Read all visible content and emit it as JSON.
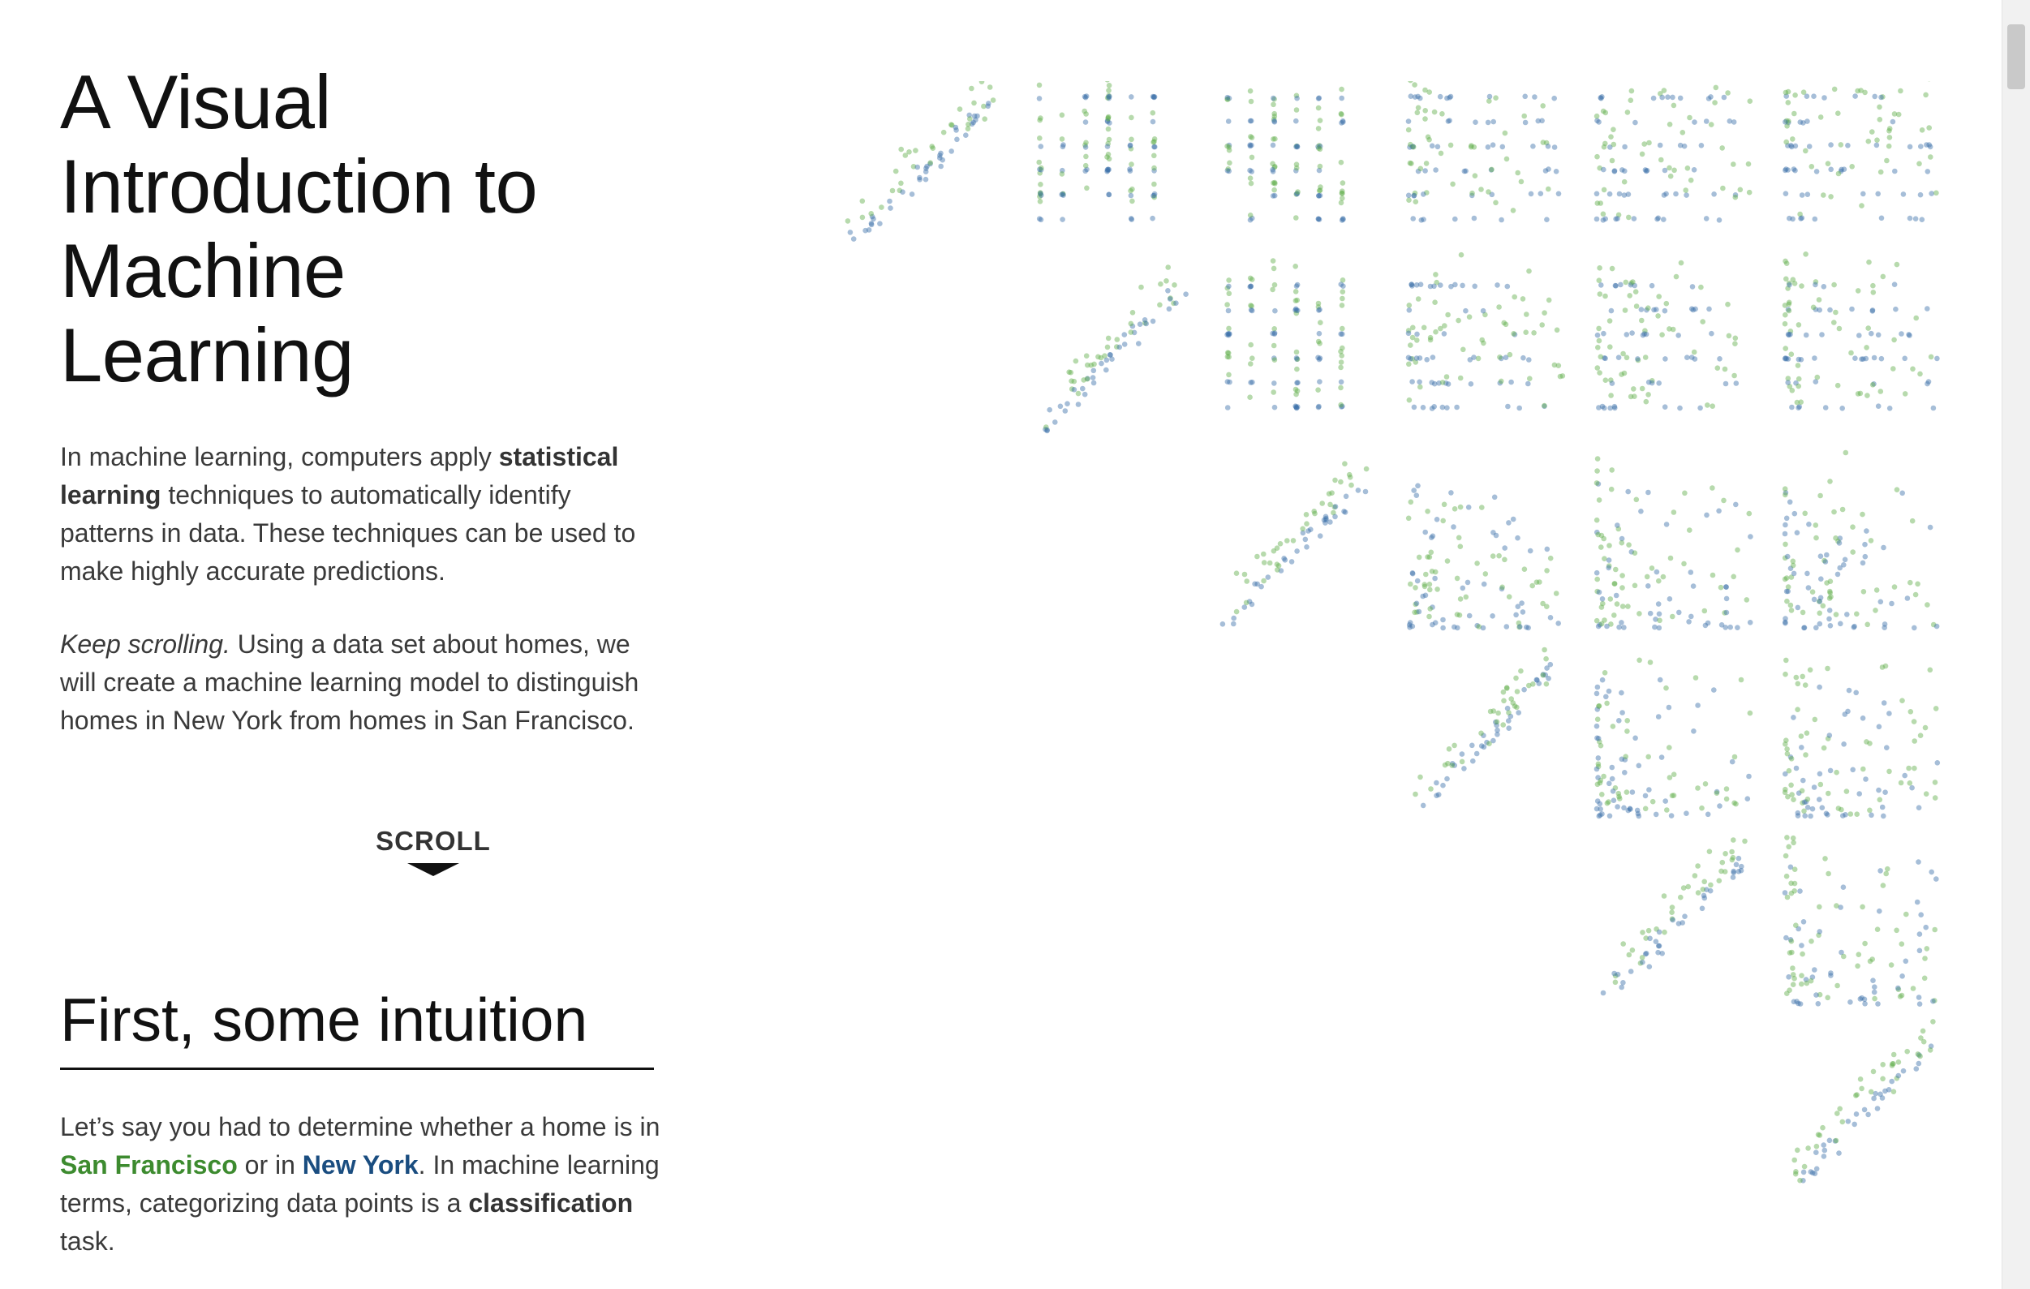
{
  "title_lines": [
    "A Visual",
    "Introduction to",
    "Machine",
    "Learning"
  ],
  "intro": {
    "t1": "In machine learning, computers apply ",
    "bold1": "statistical learning",
    "t2": " techniques to automatically identify patterns in data. These techniques can be used to make highly accurate predictions."
  },
  "keep": {
    "italic": "Keep scrolling.",
    "text": " Using a data set about homes, we will create a machine learning model to distinguish homes in New York from homes in San Francisco."
  },
  "scroll_cue": {
    "label": "SCROLL",
    "icon": "triangle-down-icon"
  },
  "section": {
    "heading": "First, some intuition",
    "t1": "Let’s say you had to determine whether a home is in ",
    "sf": "San Francisco",
    "t2": " or in ",
    "ny": "New York",
    "t3": ". In machine learning terms, categorizing data points is a ",
    "bold": "classification",
    "t4": " task."
  },
  "colors": {
    "san_francisco": "#3d8b2f",
    "new_york": "#1a4d80",
    "sf_point": "#5fae4a",
    "ny_point": "#3a6fa8"
  },
  "viz": {
    "type": "scatterplot-matrix",
    "series": [
      {
        "name": "San Francisco",
        "color": "#5fae4a"
      },
      {
        "name": "New York",
        "color": "#3a6fa8"
      }
    ]
  }
}
